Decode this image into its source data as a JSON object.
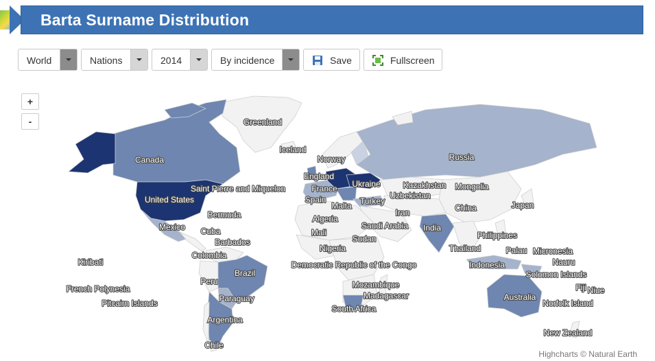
{
  "header": {
    "title": "Barta Surname Distribution"
  },
  "toolbar": {
    "region": "World",
    "level": "Nations",
    "year": "2014",
    "mode": "By incidence",
    "save_label": "Save",
    "fullscreen_label": "Fullscreen"
  },
  "map": {
    "zoom_in": "+",
    "zoom_out": "-",
    "credit": "Highcharts © Natural Earth",
    "colors": {
      "none": "#f2f2f2",
      "low": "#a5b3cc",
      "mid": "#6e86b0",
      "high": "#4a6397",
      "top": "#1c3471"
    },
    "labels": {
      "greenland": "Greenland",
      "iceland": "Iceland",
      "norway": "Norway",
      "russia": "Russia",
      "canada": "Canada",
      "england": "England",
      "ukraine": "Ukraine",
      "kazakhstan": "Kazakhstan",
      "mongolia": "Mongolia",
      "france": "France",
      "spain": "Spain",
      "turkey": "Turkey",
      "uzbekistan": "Uzbekistan",
      "stpierre": "Saint Pierre and Miquelon",
      "malta": "Malta",
      "us": "United States",
      "japan": "Japan",
      "china": "China",
      "iran": "Iran",
      "algeria": "Algeria",
      "bermuda": "Bermuda",
      "saudi": "Saudi Arabia",
      "mexico": "Mexico",
      "india": "India",
      "cuba": "Cuba",
      "mali": "Mali",
      "sudan": "Sudan",
      "philippines": "Philippines",
      "barbados": "Barbados",
      "nigeria": "Nigeria",
      "thailand": "Thailand",
      "palau": "Palau",
      "micronesia": "Micronesia",
      "colombia": "Colombia",
      "kiribati": "Kiribati",
      "nauru": "Nauru",
      "drc": "Democratic Republic of the Congo",
      "indonesia": "Indonesia",
      "brazil": "Brazil",
      "solomon": "Solomon Islands",
      "peru": "Peru",
      "mozambique": "Mozambique",
      "frenchpoly": "French Polynesia",
      "fiji": "Fiji",
      "niue": "Niue",
      "madagascar": "Madagascar",
      "australia": "Australia",
      "paraguay": "Paraguay",
      "pitcairn": "Pitcairn Islands",
      "norfolk": "Norfolk Island",
      "southafrica": "South Africa",
      "argentina": "Argentina",
      "newzealand": "New Zealand",
      "chile": "Chile"
    }
  }
}
